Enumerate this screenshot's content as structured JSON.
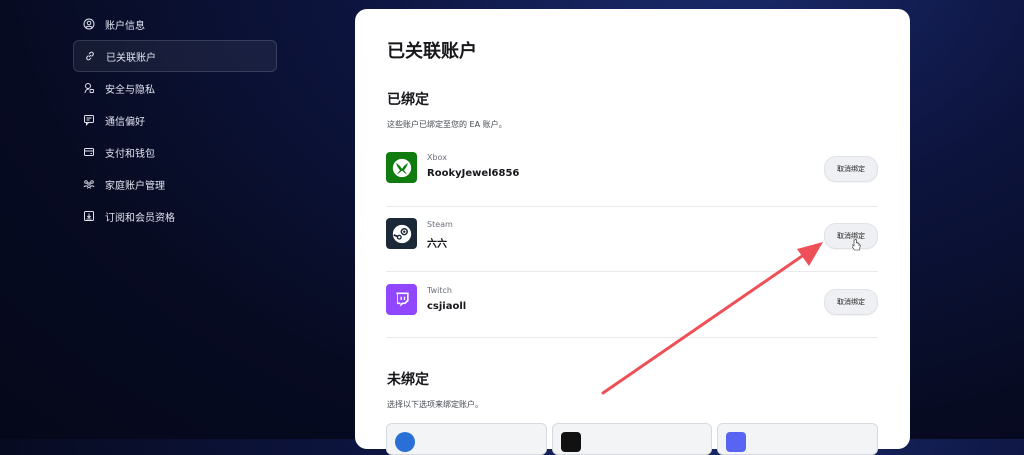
{
  "sidebar": {
    "items": [
      {
        "label": "账户信息",
        "icon": "user-circle-icon"
      },
      {
        "label": "已关联账户",
        "icon": "link-icon"
      },
      {
        "label": "安全与隐私",
        "icon": "lock-icon"
      },
      {
        "label": "通信偏好",
        "icon": "chat-icon"
      },
      {
        "label": "支付和钱包",
        "icon": "wallet-icon"
      },
      {
        "label": "家庭账户管理",
        "icon": "family-icon"
      },
      {
        "label": "订阅和会员资格",
        "icon": "subscription-icon"
      }
    ]
  },
  "main": {
    "title": "已关联账户",
    "linked": {
      "title": "已绑定",
      "description": "这些账户已绑定至您的 EA 账户。",
      "accounts": [
        {
          "platform": "Xbox",
          "username": "RookyJewel6856",
          "button": "取消绑定",
          "color": "#107c10"
        },
        {
          "platform": "Steam",
          "username": "六六",
          "button": "取消绑定",
          "color": "#1b2838"
        },
        {
          "platform": "Twitch",
          "username": "csjiaoll",
          "button": "取消绑定",
          "color": "#9146ff"
        }
      ]
    },
    "unlinked": {
      "title": "未绑定",
      "description": "选择以下选项来绑定账户。"
    }
  },
  "colors": {
    "accent": "#ef4f57"
  }
}
